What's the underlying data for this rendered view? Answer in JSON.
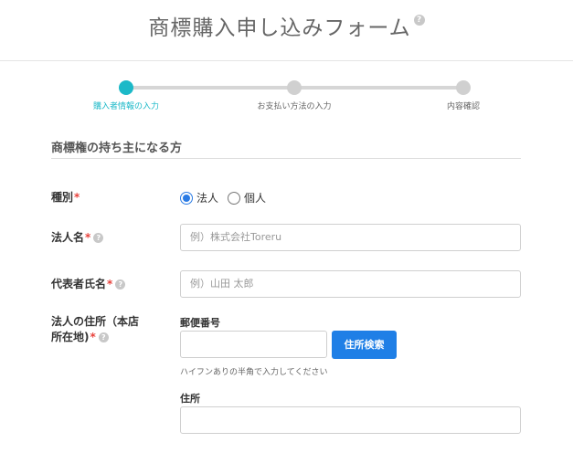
{
  "header": {
    "title": "商標購入申し込みフォーム",
    "help": "?"
  },
  "stepper": {
    "steps": [
      {
        "label": "購入者情報の入力",
        "active": true
      },
      {
        "label": "お支払い方法の入力",
        "active": false
      },
      {
        "label": "内容確認",
        "active": false
      }
    ]
  },
  "section": {
    "title": "商標権の持ち主になる方"
  },
  "form": {
    "required_mark": "*",
    "help": "?",
    "type": {
      "label": "種別",
      "options": [
        "法人",
        "個人"
      ],
      "selected": "法人"
    },
    "company_name": {
      "label": "法人名",
      "placeholder": "例）株式会社Toreru"
    },
    "representative": {
      "label": "代表者氏名",
      "placeholder": "例）山田 太郎"
    },
    "address": {
      "label_line1": "法人の住所（本店",
      "label_line2": "所在地)",
      "postal_label": "郵便番号",
      "postal_value": "",
      "search_button": "住所検索",
      "postal_hint": "ハイフンありの半角で入力してください",
      "address_label": "住所",
      "address_value": ""
    }
  },
  "colors": {
    "accent": "#1cb9c8",
    "primary_button": "#1f7fe6",
    "required": "#e8413b"
  }
}
